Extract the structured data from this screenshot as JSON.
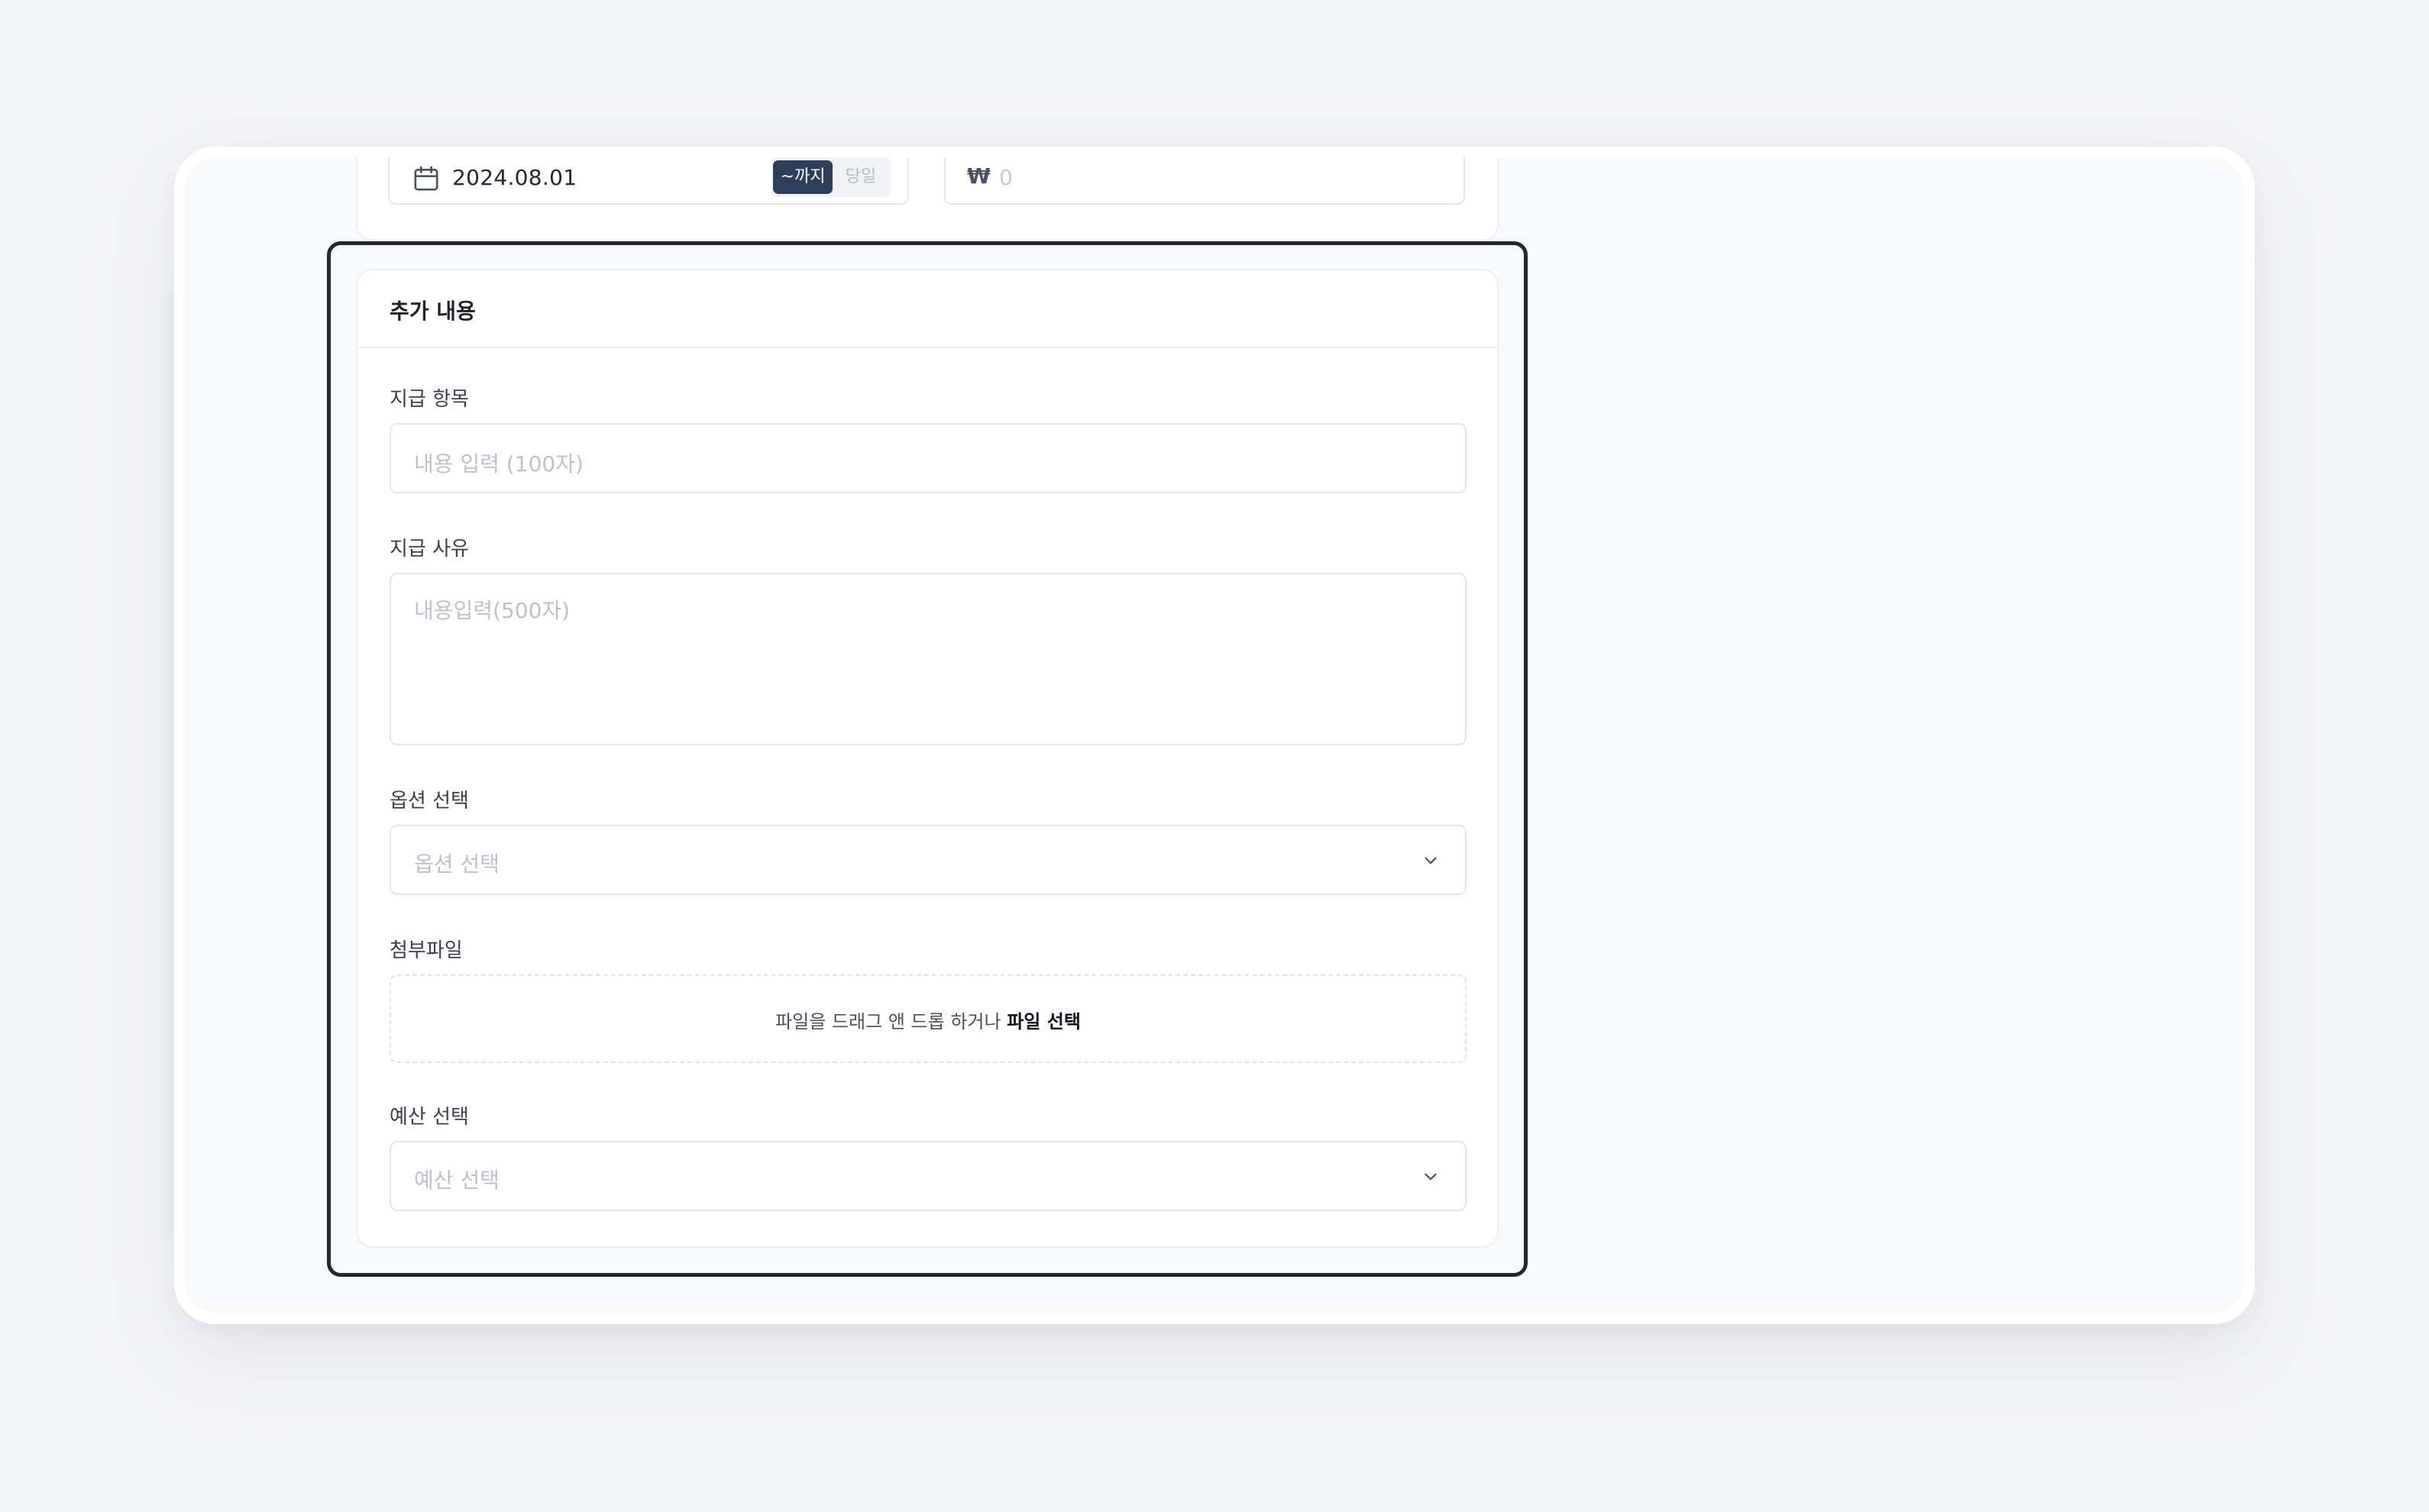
{
  "date_field": {
    "value": "2024.08.01",
    "segments": [
      "~까지",
      "당일"
    ],
    "selected_segment": "~까지"
  },
  "amount_field": {
    "currency_symbol": "₩",
    "value": "0"
  },
  "section": {
    "title": "추가 내용"
  },
  "payment_item": {
    "label": "지급 항목",
    "placeholder": "내용 입력 (100자)",
    "value": ""
  },
  "payment_reason": {
    "label": "지급 사유",
    "placeholder": "내용입력(500자)",
    "value": ""
  },
  "option_select": {
    "label": "옵션 선택",
    "placeholder": "옵션 선택"
  },
  "attachment": {
    "label": "첨부파일",
    "drop_text": "파일을 드래그 앤 드롭 하거나",
    "link_text": "파일 선택"
  },
  "budget_select": {
    "label": "예산 선택",
    "placeholder": "예산 선택"
  },
  "colors": {
    "highlight_border": "#23262b",
    "segment_active_bg": "#2e3d59",
    "page_bg": "#f4f5f7"
  }
}
